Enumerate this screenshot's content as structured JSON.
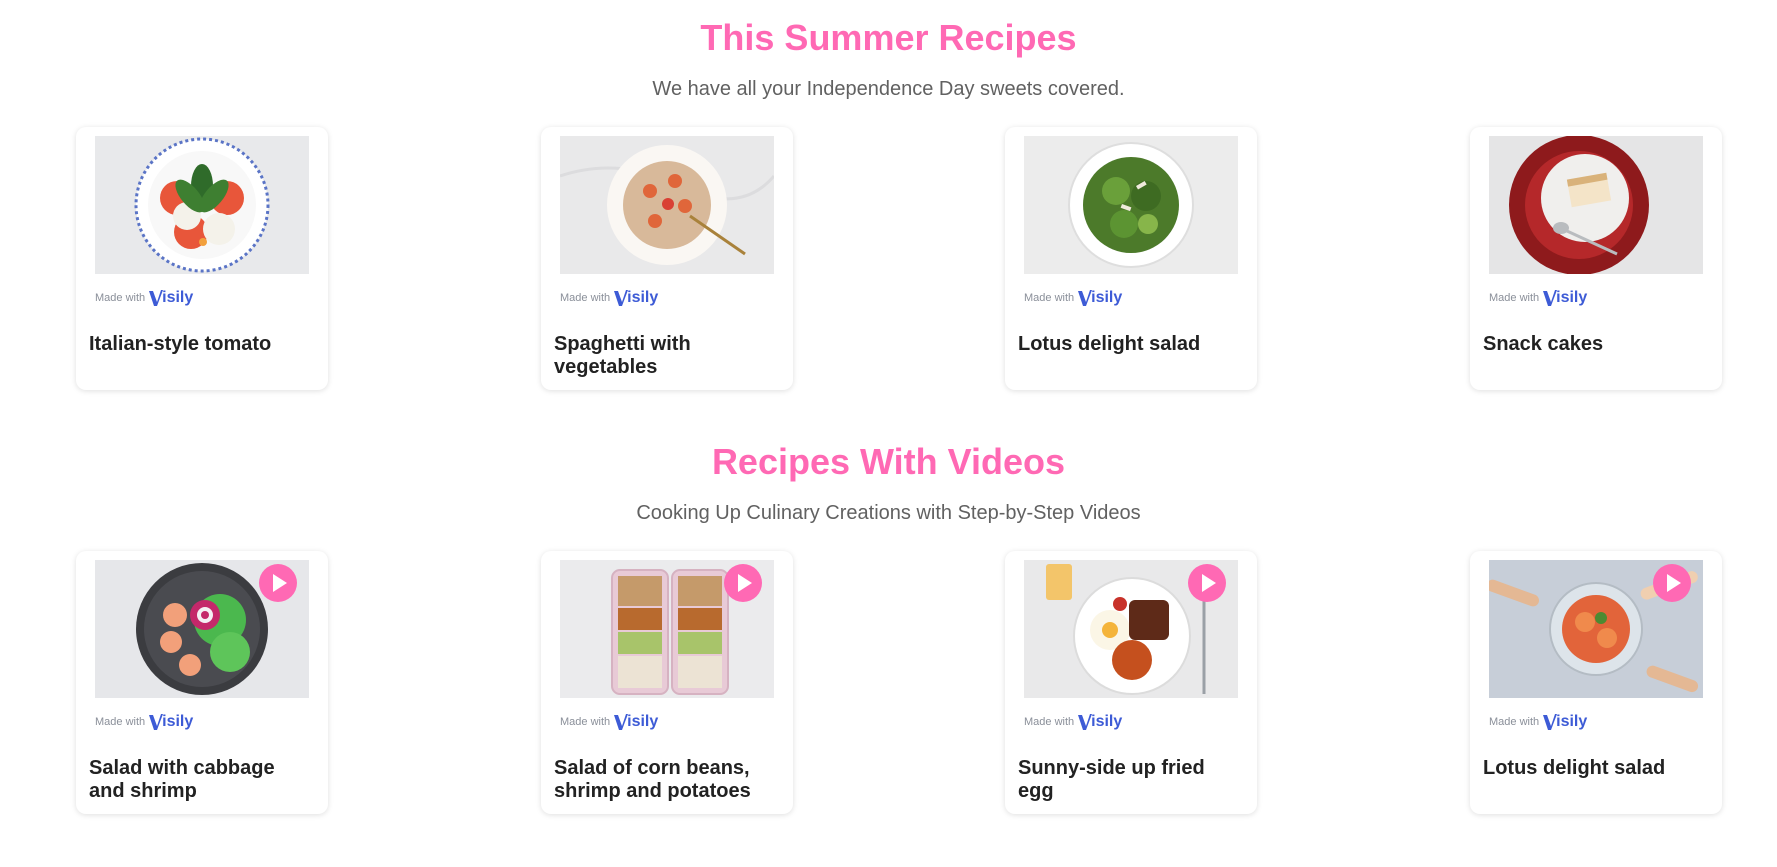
{
  "summer": {
    "title": "This Summer Recipes",
    "subtitle": "We have all your Independence Day sweets covered.",
    "cards": [
      {
        "title": "Italian-style tomato",
        "image": "caprese-salad-image"
      },
      {
        "title": "Spaghetti with vegetables",
        "image": "shrimp-spaghetti-image"
      },
      {
        "title": "Lotus delight salad",
        "image": "green-salad-image"
      },
      {
        "title": "Snack cakes",
        "image": "snack-cake-image"
      }
    ]
  },
  "videos": {
    "title": "Recipes With Videos",
    "subtitle": "Cooking Up Culinary Creations with Step-by-Step Videos",
    "cards": [
      {
        "title": "Salad with cabbage and shrimp",
        "image": "shrimp-salad-bowl-image"
      },
      {
        "title": "Salad of corn beans, shrimp and potatoes",
        "image": "meal-prep-boxes-image"
      },
      {
        "title": "Sunny-side up fried egg",
        "image": "fried-egg-breakfast-image"
      },
      {
        "title": "Lotus delight salad",
        "image": "shared-salad-image"
      }
    ]
  },
  "badge": {
    "made_with": "Made with",
    "brand": "isily"
  },
  "icons": {
    "play": "play-icon",
    "brand_logo": "visily-logo-icon"
  },
  "colors": {
    "accent": "#ff69b4",
    "heading": "#ff69b4",
    "subtitle": "#616161",
    "card_title": "#222222",
    "brand": "#3d5bd6"
  }
}
